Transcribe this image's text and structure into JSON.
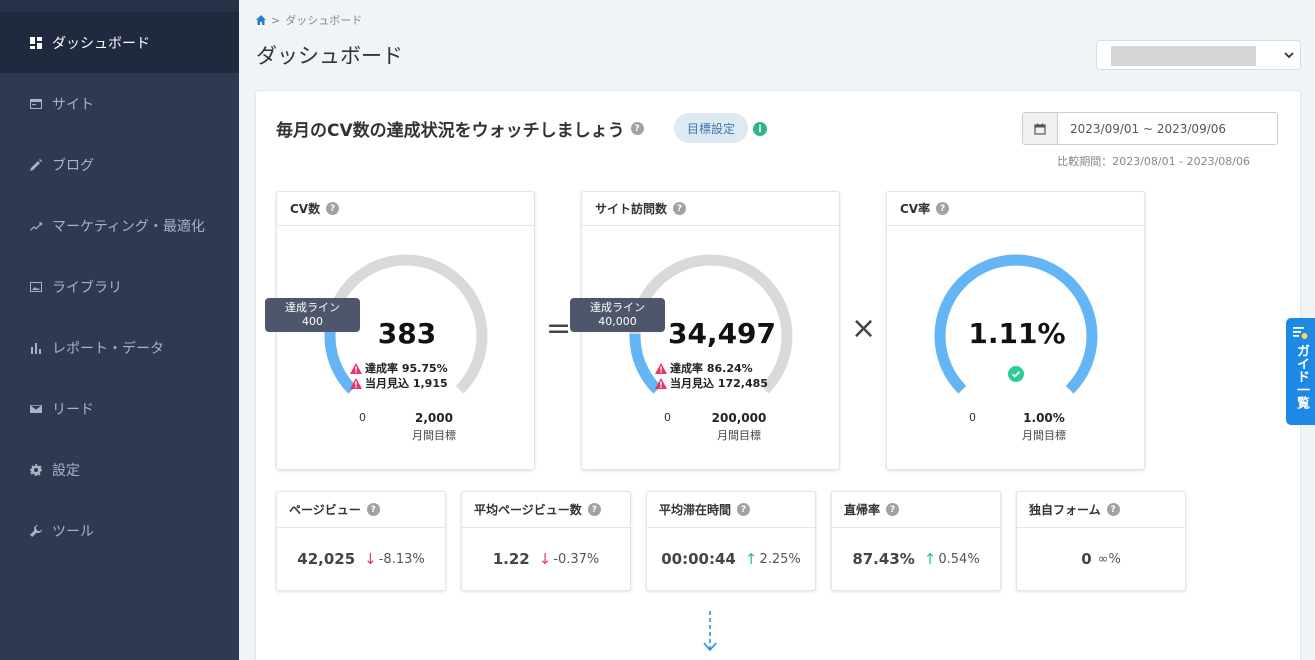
{
  "sidebar": {
    "items": [
      {
        "label": "ダッシュボード",
        "icon": "dashboard-icon",
        "active": true
      },
      {
        "label": "サイト",
        "icon": "site-icon"
      },
      {
        "label": "ブログ",
        "icon": "pencil-icon"
      },
      {
        "label": "マーケティング・最適化",
        "icon": "trend-icon"
      },
      {
        "label": "ライブラリ",
        "icon": "image-icon"
      },
      {
        "label": "レポート・データ",
        "icon": "bar-chart-icon"
      },
      {
        "label": "リード",
        "icon": "mail-icon"
      },
      {
        "label": "設定",
        "icon": "gear-icon"
      },
      {
        "label": "ツール",
        "icon": "wrench-icon"
      }
    ]
  },
  "header": {
    "breadcrumb_sep": ">",
    "breadcrumb_current": "ダッシュボード",
    "title": "ダッシュボード",
    "site_select_value": ""
  },
  "panel": {
    "headline": "毎月のCV数の達成状況をウォッチしましょう",
    "help_glyph": "?",
    "goal_button": "目標設定",
    "info_glyph": "i",
    "date_range": "2023/09/01 ~ 2023/09/06",
    "compare_period": "比較期間：2023/08/01 - 2023/08/06"
  },
  "kpis": {
    "cv": {
      "title": "CV数",
      "value": "383",
      "line_label": "達成ライン",
      "line_value": "400",
      "achievement": "達成率 95.75%",
      "forecast": "当月見込 1,915",
      "min": "0",
      "max": "2,000",
      "target_label": "月間目標",
      "progress": 0.1915,
      "line_fraction": 0.2
    },
    "visits": {
      "title": "サイト訪問数",
      "value": "34,497",
      "line_label": "達成ライン",
      "line_value": "40,000",
      "achievement": "達成率 86.24%",
      "forecast": "当月見込 172,485",
      "min": "0",
      "max": "200,000",
      "target_label": "月間目標",
      "progress": 0.1725,
      "line_fraction": 0.2
    },
    "cvr": {
      "title": "CV率",
      "value": "1.11%",
      "min": "0",
      "max": "1.00%",
      "target_label": "月間目標",
      "progress": 1.0
    },
    "operators": {
      "equals": "=",
      "times": "×"
    }
  },
  "metrics": [
    {
      "title": "ページビュー",
      "value": "42,025",
      "direction": "down",
      "delta": "-8.13%"
    },
    {
      "title": "平均ページビュー数",
      "value": "1.22",
      "direction": "down",
      "delta": "-0.37%"
    },
    {
      "title": "平均滞在時間",
      "value": "00:00:44",
      "direction": "up",
      "delta": "2.25%"
    },
    {
      "title": "直帰率",
      "value": "87.43%",
      "direction": "up",
      "delta": "0.54%"
    },
    {
      "title": "独自フォーム",
      "value": "0",
      "direction": "none",
      "delta": "∞%"
    }
  ],
  "arrows": {
    "down": "↓",
    "up": "↑"
  },
  "guide_tab": {
    "label": "ガイド一覧"
  },
  "colors": {
    "sidebar_bg": "#2e3a52",
    "sidebar_active": "#1f2940",
    "gauge_fill": "#64b5f6",
    "gauge_track": "#d9d9d9",
    "warn": "#e8336d",
    "success": "#2bcb94",
    "down": "#e2404f",
    "up": "#2cc091",
    "guide": "#1e88e5"
  }
}
